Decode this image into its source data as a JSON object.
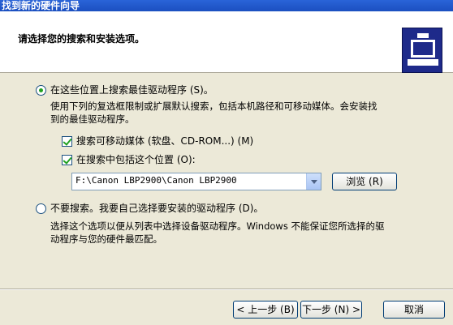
{
  "window": {
    "title": "找到新的硬件向导"
  },
  "header": {
    "title": "请选择您的搜索和安装选项。"
  },
  "options": {
    "search_best": {
      "label": "在这些位置上搜索最佳驱动程序 (S)。",
      "selected": true,
      "description_line1": "使用下列的复选框限制或扩展默认搜索，包括本机路径和可移动媒体。会安装找",
      "description_line2": "到的最佳驱动程序。",
      "search_removable": {
        "label": "搜索可移动媒体 (软盘、CD-ROM...) (M)",
        "checked": true
      },
      "include_location": {
        "label": "在搜索中包括这个位置 (O):",
        "checked": true
      },
      "location_value": "F:\\Canon LBP2900\\Canon LBP2900",
      "browse_label": "浏览 (R)"
    },
    "dont_search": {
      "label": "不要搜索。我要自己选择要安装的驱动程序 (D)。",
      "selected": false,
      "description_line1": "选择这个选项以便从列表中选择设备驱动程序。Windows 不能保证您所选择的驱",
      "description_line2": "动程序与您的硬件最匹配。"
    }
  },
  "buttons": {
    "back": "< 上一步 (B)",
    "next": "下一步 (N) >",
    "cancel": "取消"
  }
}
